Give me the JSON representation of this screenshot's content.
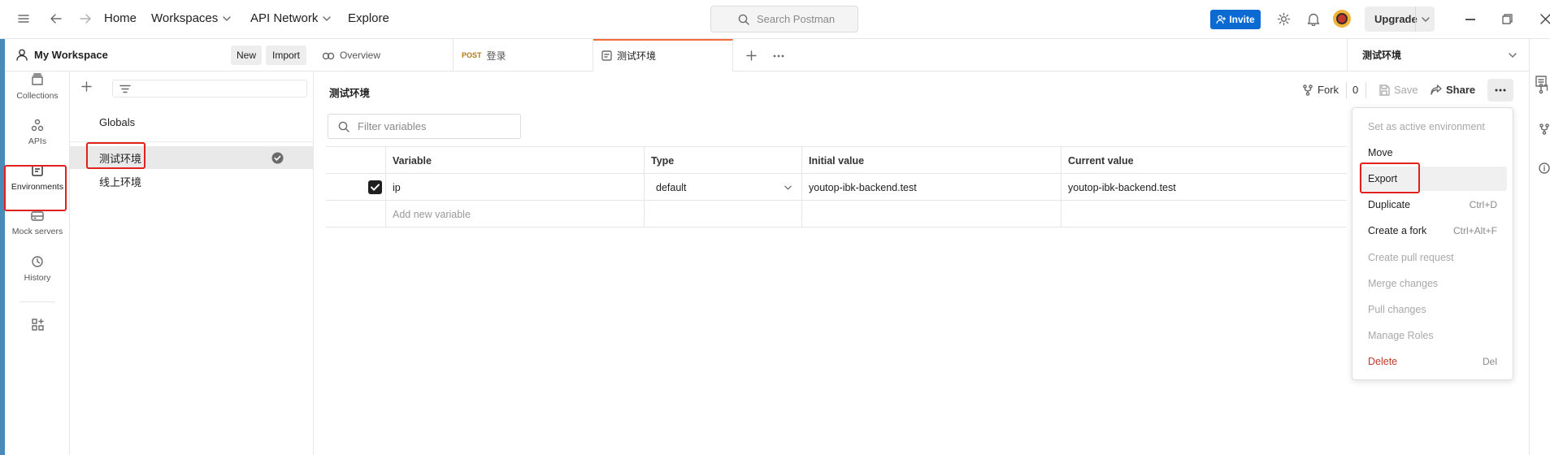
{
  "topbar": {
    "home": "Home",
    "workspaces": "Workspaces",
    "api_network": "API Network",
    "explore": "Explore",
    "search_placeholder": "Search Postman",
    "invite": "Invite",
    "upgrade": "Upgrade"
  },
  "workspace": {
    "title": "My Workspace",
    "new": "New",
    "import": "Import"
  },
  "tabs": [
    {
      "label": "Overview"
    },
    {
      "method": "POST",
      "label": "登录"
    },
    {
      "label": "测试环境"
    }
  ],
  "right_panel": {
    "title": "测试环境"
  },
  "icon_nav": [
    {
      "label": "Collections"
    },
    {
      "label": "APIs"
    },
    {
      "label": "Environments"
    },
    {
      "label": "Mock servers"
    },
    {
      "label": "History"
    }
  ],
  "sidebar": {
    "items": [
      {
        "label": "Globals"
      },
      {
        "label": "测试环境"
      },
      {
        "label": "线上环境"
      }
    ]
  },
  "main": {
    "title": "测试环境",
    "filter_placeholder": "Filter variables",
    "fork": "Fork",
    "fork_count": "0",
    "save": "Save",
    "share": "Share",
    "table": {
      "headers": [
        "Variable",
        "Type",
        "Initial value",
        "Current value"
      ],
      "rows": [
        {
          "checked": true,
          "variable": "ip",
          "type": "default",
          "initial": "youtop-ibk-backend.test",
          "current": "youtop-ibk-backend.test"
        }
      ],
      "add_placeholder": "Add new variable"
    }
  },
  "menu": {
    "items": [
      {
        "label": "Set as active environment",
        "shortcut": "",
        "state": "disabled"
      },
      {
        "label": "Move",
        "shortcut": "",
        "state": "normal"
      },
      {
        "label": "Export",
        "shortcut": "",
        "state": "hover"
      },
      {
        "label": "Duplicate",
        "shortcut": "Ctrl+D",
        "state": "normal"
      },
      {
        "label": "Create a fork",
        "shortcut": "Ctrl+Alt+F",
        "state": "normal"
      },
      {
        "label": "Create pull request",
        "shortcut": "",
        "state": "disabled"
      },
      {
        "label": "Merge changes",
        "shortcut": "",
        "state": "disabled"
      },
      {
        "label": "Pull changes",
        "shortcut": "",
        "state": "disabled"
      },
      {
        "label": "Manage Roles",
        "shortcut": "",
        "state": "disabled"
      },
      {
        "label": "Delete",
        "shortcut": "Del",
        "state": "danger"
      }
    ]
  },
  "colors": {
    "accent_tab": "#f26b3a",
    "invite_blue": "#0b6bd3",
    "highlight_red": "#e0211d",
    "danger": "#c0392b"
  }
}
